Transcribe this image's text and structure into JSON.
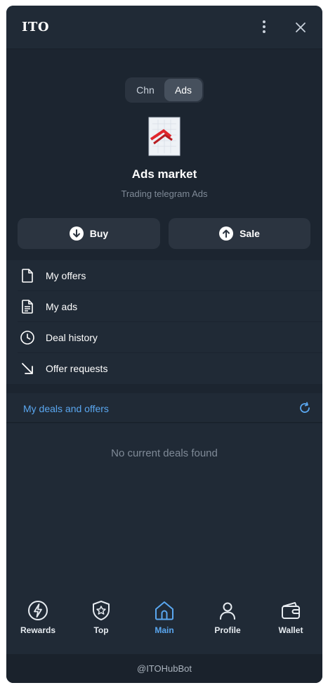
{
  "header": {
    "title": "ITO",
    "menu_icon": "more-vertical-icon",
    "close_icon": "close-icon"
  },
  "segment": {
    "options": [
      "Chn",
      "Ads"
    ],
    "selected": "Ads"
  },
  "hero": {
    "title": "Ads market",
    "subtitle": "Trading telegram Ads"
  },
  "actions": {
    "buy": "Buy",
    "sale": "Sale"
  },
  "menu": [
    {
      "label": "My offers",
      "icon": "file-icon"
    },
    {
      "label": "My ads",
      "icon": "document-text-icon"
    },
    {
      "label": "Deal history",
      "icon": "clock-icon"
    },
    {
      "label": "Offer requests",
      "icon": "arrow-down-right-icon"
    }
  ],
  "deals": {
    "title": "My deals and offers",
    "empty": "No current deals found"
  },
  "tabs": [
    {
      "label": "Rewards",
      "icon": "lightning-icon",
      "active": false
    },
    {
      "label": "Top",
      "icon": "star-badge-icon",
      "active": false
    },
    {
      "label": "Main",
      "icon": "home-icon",
      "active": true
    },
    {
      "label": "Profile",
      "icon": "user-icon",
      "active": false
    },
    {
      "label": "Wallet",
      "icon": "wallet-icon",
      "active": false
    }
  ],
  "footer": {
    "bot": "@ITOHubBot"
  },
  "colors": {
    "accent": "#5aa7f0",
    "background": "#1c2530",
    "surface": "#202a36"
  }
}
